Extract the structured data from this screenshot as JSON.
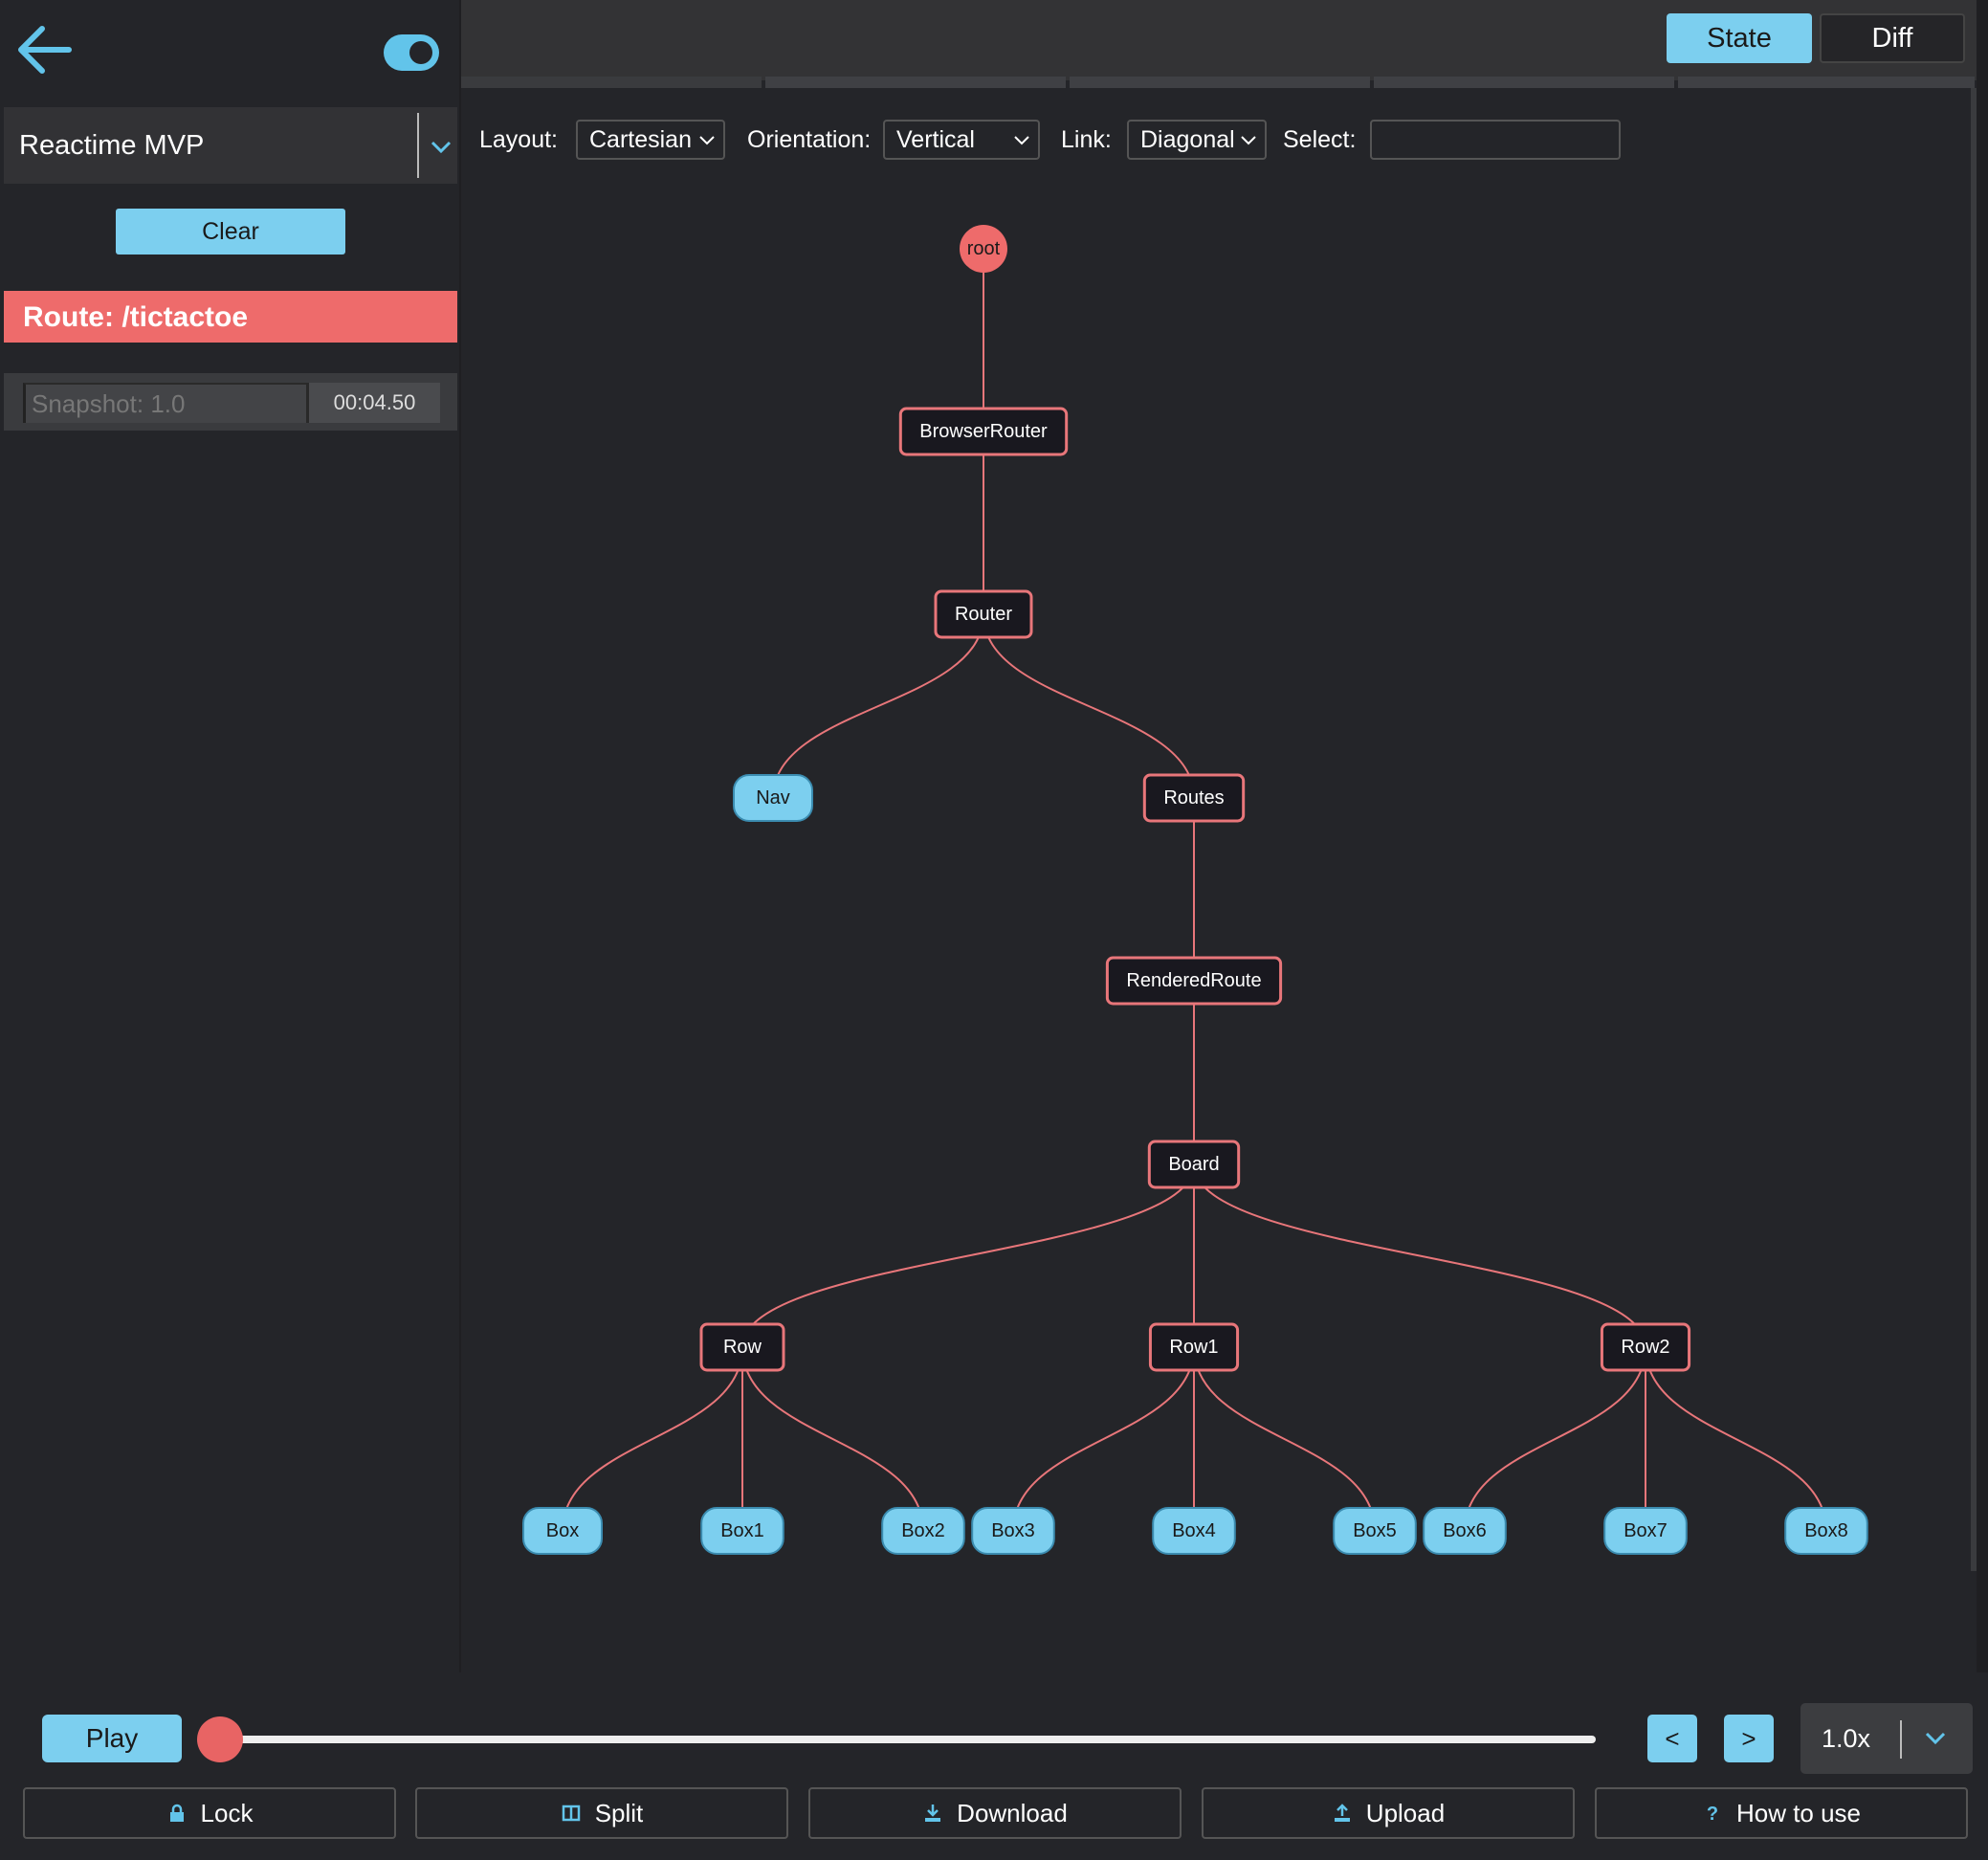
{
  "sidebar": {
    "app_name": "Reactime MVP",
    "clear_label": "Clear",
    "route_label": "Route: /tictactoe",
    "snapshot_label": "Snapshot: 1.0",
    "snapshot_time": "00:04.50"
  },
  "tabs": {
    "state_label": "State",
    "diff_label": "Diff",
    "active": "State"
  },
  "controls": {
    "layout_label": "Layout:",
    "layout_value": "Cartesian",
    "orientation_label": "Orientation:",
    "orientation_value": "Vertical",
    "link_label": "Link:",
    "link_value": "Diagonal",
    "select_label": "Select:",
    "select_value": ""
  },
  "tree": {
    "nodes": [
      {
        "id": "root",
        "label": "root",
        "parent": null,
        "kind": "root"
      },
      {
        "id": "browserrouter",
        "label": "BrowserRouter",
        "parent": "root",
        "kind": "component"
      },
      {
        "id": "router",
        "label": "Router",
        "parent": "browserrouter",
        "kind": "component"
      },
      {
        "id": "nav",
        "label": "Nav",
        "parent": "router",
        "kind": "leaf"
      },
      {
        "id": "routes",
        "label": "Routes",
        "parent": "router",
        "kind": "component"
      },
      {
        "id": "renderedroute",
        "label": "RenderedRoute",
        "parent": "routes",
        "kind": "component"
      },
      {
        "id": "board",
        "label": "Board",
        "parent": "renderedroute",
        "kind": "component"
      },
      {
        "id": "row",
        "label": "Row",
        "parent": "board",
        "kind": "component"
      },
      {
        "id": "row1",
        "label": "Row1",
        "parent": "board",
        "kind": "component"
      },
      {
        "id": "row2",
        "label": "Row2",
        "parent": "board",
        "kind": "component"
      },
      {
        "id": "box",
        "label": "Box",
        "parent": "row",
        "kind": "leaf"
      },
      {
        "id": "box1",
        "label": "Box1",
        "parent": "row",
        "kind": "leaf"
      },
      {
        "id": "box2",
        "label": "Box2",
        "parent": "row",
        "kind": "leaf"
      },
      {
        "id": "box3",
        "label": "Box3",
        "parent": "row1",
        "kind": "leaf"
      },
      {
        "id": "box4",
        "label": "Box4",
        "parent": "row1",
        "kind": "leaf"
      },
      {
        "id": "box5",
        "label": "Box5",
        "parent": "row1",
        "kind": "leaf"
      },
      {
        "id": "box6",
        "label": "Box6",
        "parent": "row2",
        "kind": "leaf"
      },
      {
        "id": "box7",
        "label": "Box7",
        "parent": "row2",
        "kind": "leaf"
      },
      {
        "id": "box8",
        "label": "Box8",
        "parent": "row2",
        "kind": "leaf"
      }
    ]
  },
  "playback": {
    "play_label": "Play",
    "prev_label": "<",
    "next_label": ">",
    "speed_value": "1.0x",
    "progress": 0
  },
  "actions": {
    "lock_label": "Lock",
    "split_label": "Split",
    "download_label": "Download",
    "upload_label": "Upload",
    "howto_label": "How to use"
  },
  "colors": {
    "accent_blue": "#7ccfef",
    "accent_red": "#ee6b6b",
    "node_bg": "#19181f",
    "link": "#e8767a",
    "background": "#242529"
  },
  "icons": {
    "back": "arrow-left-icon",
    "toggle": "toggle-icon",
    "chevron": "chevron-down-icon",
    "lock": "lock-icon",
    "split": "split-icon",
    "download": "download-icon",
    "upload": "upload-icon",
    "help": "question-icon"
  }
}
